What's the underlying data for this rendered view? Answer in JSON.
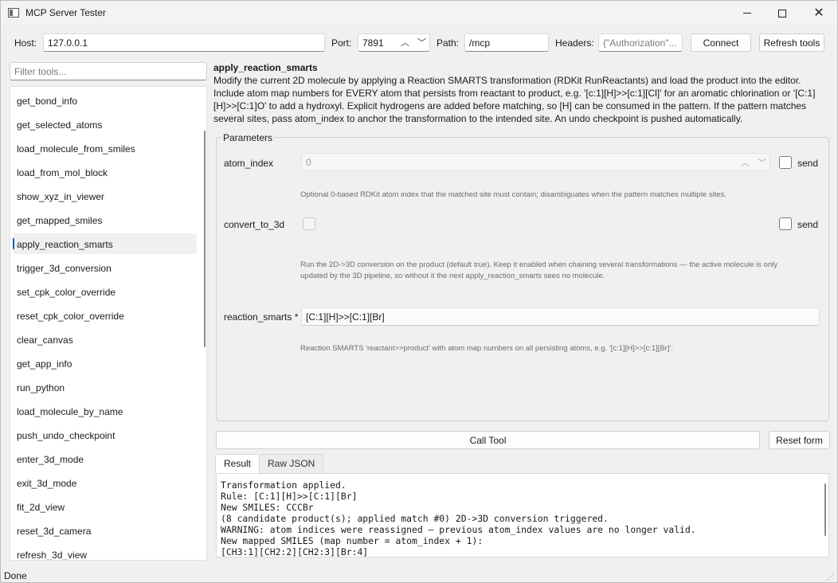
{
  "window": {
    "title": "MCP Server Tester"
  },
  "connection": {
    "host_label": "Host:",
    "host_value": "127.0.0.1",
    "port_label": "Port:",
    "port_value": "7891",
    "path_label": "Path:",
    "path_value": "/mcp",
    "headers_label": "Headers:",
    "headers_value": "{\"Authorization\"...",
    "connect_label": "Connect",
    "refresh_label": "Refresh tools"
  },
  "sidebar": {
    "filter_placeholder": "Filter tools...",
    "items": [
      "get_bond_info",
      "get_selected_atoms",
      "load_molecule_from_smiles",
      "load_from_mol_block",
      "show_xyz_in_viewer",
      "get_mapped_smiles",
      "apply_reaction_smarts",
      "trigger_3d_conversion",
      "set_cpk_color_override",
      "reset_cpk_color_override",
      "clear_canvas",
      "get_app_info",
      "run_python",
      "load_molecule_by_name",
      "push_undo_checkpoint",
      "enter_3d_mode",
      "exit_3d_mode",
      "fit_2d_view",
      "reset_3d_camera",
      "refresh_3d_view"
    ],
    "selected": "apply_reaction_smarts"
  },
  "tool": {
    "name": "apply_reaction_smarts",
    "description": "Modify the current 2D molecule by applying a Reaction SMARTS transformation (RDKit RunReactants) and load the product into the editor. Include atom map numbers for EVERY atom that persists from reactant to product, e.g. '[c:1][H]>>[c:1][Cl]' for an aromatic chlorination or '[C:1][H]>>[C:1]O' to add a hydroxyl. Explicit hydrogens are added before matching, so [H] can be consumed in the pattern. If the pattern matches several sites, pass atom_index to anchor the transformation to the intended site. An undo checkpoint is pushed automatically."
  },
  "params": {
    "legend": "Parameters",
    "send_label": "send",
    "atom_index": {
      "label": "atom_index",
      "value": "0",
      "hint": "Optional 0-based RDKit atom index that the matched site must contain; disambiguates when the pattern matches multiple sites."
    },
    "convert_to_3d": {
      "label": "convert_to_3d",
      "hint_line1": "Run the 2D->3D conversion on the product (default true). Keep it enabled when chaining several transformations — the active molecule is only",
      "hint_line2": "updated by the 3D pipeline, so without it the next apply_reaction_smarts sees no molecule."
    },
    "reaction_smarts": {
      "label": "reaction_smarts *",
      "value": "[C:1][H]>>[C:1][Br]",
      "hint": "Reaction SMARTS 'reactant>>product' with atom map numbers on all persisting atoms, e.g. '[c:1][H]>>[c:1][Br]'."
    }
  },
  "actions": {
    "call_label": "Call Tool",
    "reset_label": "Reset form"
  },
  "tabs": {
    "result": "Result",
    "raw_json": "Raw JSON"
  },
  "result_text": "Transformation applied.\nRule: [C:1][H]>>[C:1][Br]\nNew SMILES: CCCBr\n(8 candidate product(s); applied match #0) 2D->3D conversion triggered.\nWARNING: atom indices were reassigned — previous atom_index values are no longer valid.\nNew mapped SMILES (map number = atom_index + 1):\n[CH3:1][CH2:2][CH2:3][Br:4]",
  "status": {
    "text": "Done"
  }
}
